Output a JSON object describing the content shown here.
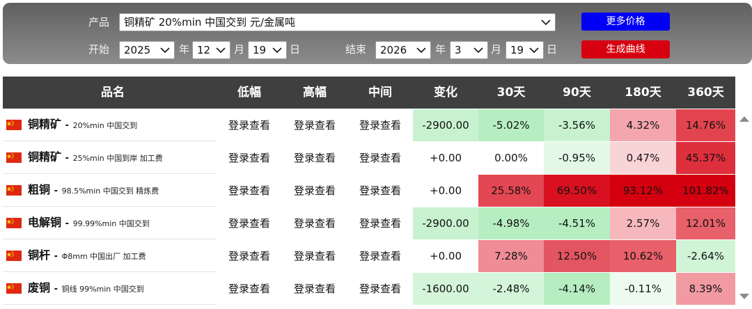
{
  "controls": {
    "product_label": "产品",
    "product_value": "铜精矿 20%min 中国交到 元/金属吨",
    "start_label": "开始",
    "start_year": "2025",
    "start_month": "12",
    "start_day": "19",
    "end_label": "结束",
    "end_year": "2026",
    "end_month": "3",
    "end_day": "19",
    "year_unit": "年",
    "month_unit": "月",
    "day_unit": "日",
    "more_prices_button": "更多价格",
    "generate_curve_button": "生成曲线"
  },
  "table": {
    "headers": [
      "品名",
      "低幅",
      "高幅",
      "中间",
      "变化",
      "30天",
      "90天",
      "180天",
      "360天"
    ],
    "rows": [
      {
        "name": "铜精矿",
        "spec": "20%min 中国交到",
        "low": "登录查看",
        "high": "登录查看",
        "mid": "登录查看",
        "change": "-2900.00",
        "d30": "-5.02%",
        "d90": "-3.56%",
        "d180": "4.32%",
        "d360": "14.76%",
        "colors": {
          "change": "#c8f2cf",
          "d30": "#b6eec1",
          "d90": "#c8f2cf",
          "d180": "#f3a6ad",
          "d360": "#e2444f"
        }
      },
      {
        "name": "铜精矿",
        "spec": "25%min 中国到岸 加工费",
        "low": "登录查看",
        "high": "登录查看",
        "mid": "登录查看",
        "change": "+0.00",
        "d30": "0.00%",
        "d90": "-0.95%",
        "d180": "0.47%",
        "d360": "45.37%",
        "colors": {
          "change": "#ffffff",
          "d30": "#ffffff",
          "d90": "#e3f8e6",
          "d180": "#f9d4d7",
          "d360": "#de2f3d"
        }
      },
      {
        "name": "粗铜",
        "spec": "98.5%min 中国交到 精炼费",
        "low": "登录查看",
        "high": "登录查看",
        "mid": "登录查看",
        "change": "+0.00",
        "d30": "25.58%",
        "d90": "69.50%",
        "d180": "93.12%",
        "d360": "101.82%",
        "colors": {
          "change": "#ffffff",
          "d30": "#e34753",
          "d90": "#d9101f",
          "d180": "#d4000f",
          "d360": "#d4000f"
        }
      },
      {
        "name": "电解铜",
        "spec": "99.99%min 中国交到",
        "low": "登录查看",
        "high": "登录查看",
        "mid": "登录查看",
        "change": "-2900.00",
        "d30": "-4.98%",
        "d90": "-4.51%",
        "d180": "2.57%",
        "d360": "12.01%",
        "colors": {
          "change": "#c8f2cf",
          "d30": "#b6eec1",
          "d90": "#b6eec1",
          "d180": "#f6b8bd",
          "d360": "#e7606a"
        }
      },
      {
        "name": "铜杆",
        "spec": "Φ8mm 中国出厂 加工费",
        "low": "登录查看",
        "high": "登录查看",
        "mid": "登录查看",
        "change": "+0.00",
        "d30": "7.28%",
        "d90": "12.50%",
        "d180": "10.62%",
        "d360": "-2.64%",
        "colors": {
          "change": "#ffffff",
          "d30": "#ef8c95",
          "d90": "#e35561",
          "d180": "#e7606a",
          "d360": "#d0f4d6"
        }
      },
      {
        "name": "废铜",
        "spec": "铜线 99%min 中国交到",
        "low": "登录查看",
        "high": "登录查看",
        "mid": "登录查看",
        "change": "-1600.00",
        "d30": "-2.48%",
        "d90": "-4.14%",
        "d180": "-0.11%",
        "d360": "8.39%",
        "colors": {
          "change": "#d5f5da",
          "d30": "#d5f5da",
          "d90": "#b6eec1",
          "d180": "#edfbef",
          "d360": "#f19aa2"
        }
      }
    ]
  },
  "icons": {
    "flag": "china-flag-icon",
    "dropdown": "chevron-down-icon",
    "scroll_up": "scroll-up-arrow-icon",
    "scroll_down": "scroll-down-arrow-icon"
  }
}
